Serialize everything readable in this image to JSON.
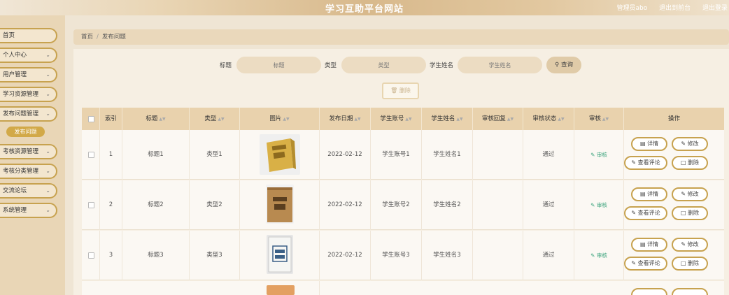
{
  "header": {
    "title": "学习互助平台网站",
    "links": [
      "管理员abo",
      "退出到前台",
      "退出登录"
    ]
  },
  "sidebar": {
    "items": [
      {
        "label": "首页",
        "chevron": false
      },
      {
        "label": "个人中心",
        "chevron": true
      },
      {
        "label": "用户管理",
        "chevron": true
      },
      {
        "label": "学习资源管理",
        "chevron": true
      },
      {
        "label": "发布问题管理",
        "chevron": true
      },
      {
        "label": "考核资源管理",
        "chevron": true
      },
      {
        "label": "考核分类管理",
        "chevron": true
      },
      {
        "label": "交流论坛",
        "chevron": true
      },
      {
        "label": "系统管理",
        "chevron": true
      }
    ],
    "active_sub": "发布问题"
  },
  "breadcrumb": {
    "home": "首页",
    "sep": "/",
    "current": "发布问题"
  },
  "search": {
    "title_label": "标题",
    "title_placeholder": "标题",
    "type_label": "类型",
    "type_placeholder": "类型",
    "name_label": "学生姓名",
    "name_placeholder": "学生姓名",
    "button": "查询"
  },
  "toolbar": {
    "delete": "删除"
  },
  "table": {
    "headers": [
      "索引",
      "标题",
      "类型",
      "图片",
      "发布日期",
      "学生账号",
      "学生姓名",
      "审核回复",
      "审核状态",
      "审核",
      "操作"
    ],
    "rows": [
      {
        "index": "1",
        "title": "标题1",
        "type": "类型1",
        "date": "2022-02-12",
        "account": "学生账号1",
        "name": "学生姓名1",
        "reply": "",
        "status": "通过",
        "review": "审核"
      },
      {
        "index": "2",
        "title": "标题2",
        "type": "类型2",
        "date": "2022-02-12",
        "account": "学生账号2",
        "name": "学生姓名2",
        "reply": "",
        "status": "通过",
        "review": "审核"
      },
      {
        "index": "3",
        "title": "标题3",
        "type": "类型3",
        "date": "2022-02-12",
        "account": "学生账号3",
        "name": "学生姓名3",
        "reply": "",
        "status": "通过",
        "review": "审核"
      }
    ],
    "row_actions": {
      "detail": "详情",
      "edit": "修改",
      "comments": "查看评论",
      "delete": "删除"
    }
  },
  "colors": {
    "accent": "#c7a24f",
    "header": "#d8b98c",
    "sidebar": "#e9d6b6",
    "review": "#3aa37c"
  }
}
